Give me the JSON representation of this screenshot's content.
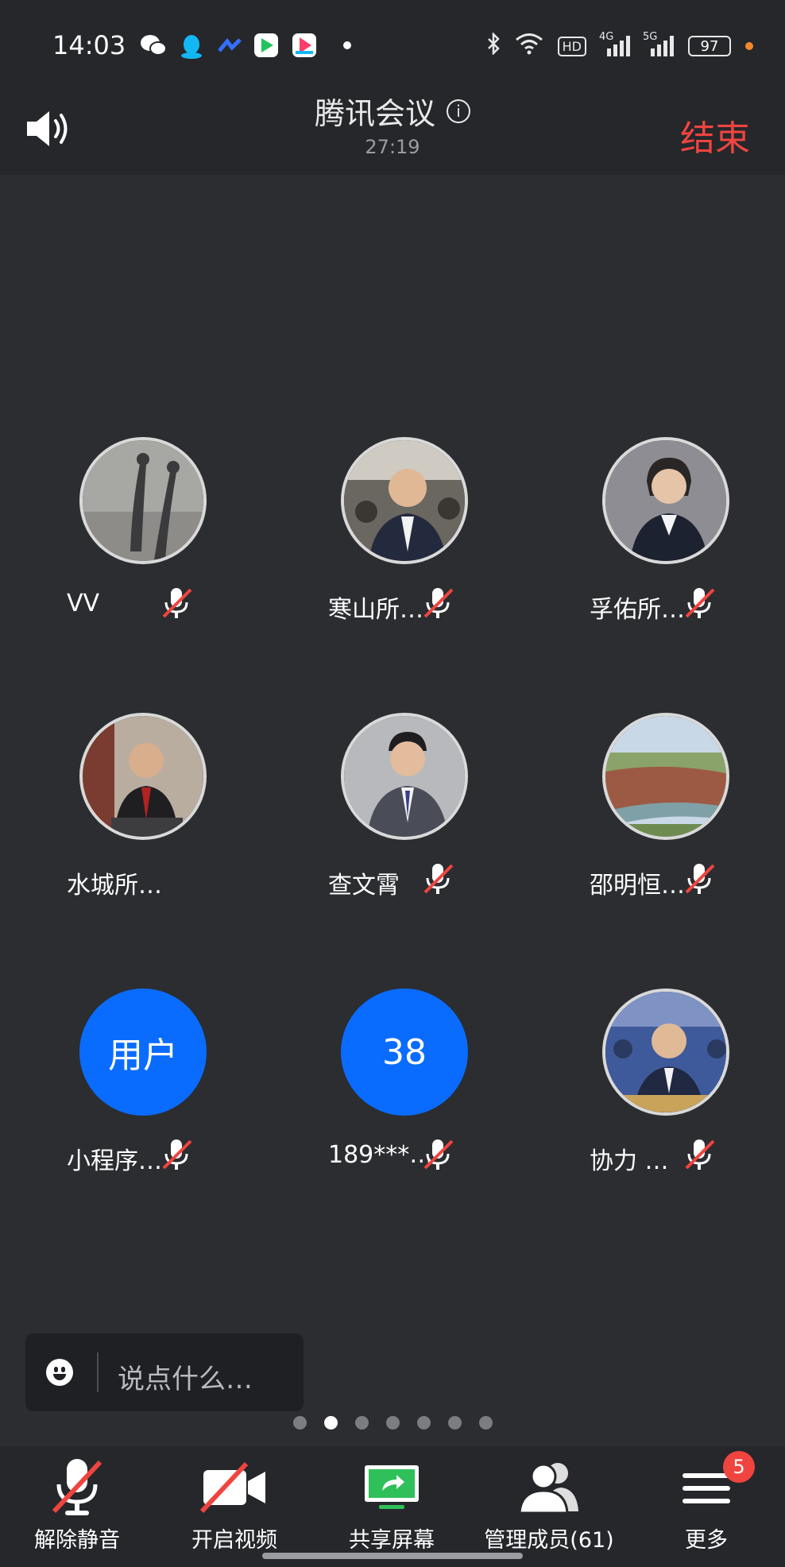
{
  "status_bar": {
    "time": "14:03",
    "app_icons": [
      {
        "icon": "wechat-icon",
        "color": "#ffffff"
      },
      {
        "icon": "qq-icon",
        "color": "#12b7f5"
      },
      {
        "icon": "feishu-icon",
        "color": "#3370ff"
      },
      {
        "icon": "video-app-icon",
        "color": "#20c45a"
      },
      {
        "icon": "music-app-icon",
        "color": "#ff3d6b"
      }
    ],
    "hd_label": "HD",
    "net_4g": "4G",
    "net_5g": "5G",
    "battery": "97"
  },
  "header": {
    "title": "腾讯会议",
    "timer": "27:19",
    "end_label": "结束"
  },
  "participants": [
    {
      "name": "VV",
      "avatar_type": "photo",
      "muted": true
    },
    {
      "name": "寒山所…",
      "avatar_type": "photo",
      "muted": true
    },
    {
      "name": "孚佑所…",
      "avatar_type": "photo",
      "muted": true
    },
    {
      "name": "水城所…",
      "avatar_type": "photo",
      "muted": false
    },
    {
      "name": "查文霄",
      "avatar_type": "photo",
      "muted": true
    },
    {
      "name": "邵明恒…",
      "avatar_type": "photo",
      "muted": true
    },
    {
      "name": "小程序…",
      "avatar_type": "initials",
      "initials": "用户",
      "muted": true
    },
    {
      "name": "189***…",
      "avatar_type": "initials",
      "initials": "38",
      "muted": true
    },
    {
      "name": "协力 …",
      "avatar_type": "photo",
      "muted": true
    }
  ],
  "chat": {
    "placeholder": "说点什么…"
  },
  "pagination": {
    "total": 7,
    "current": 2
  },
  "toolbar": {
    "unmute_label": "解除静音",
    "video_label": "开启视频",
    "share_label": "共享屏幕",
    "members_label": "管理成员(61)",
    "more_label": "更多",
    "more_badge": "5"
  },
  "colors": {
    "accent_blue": "#0a6cff",
    "end_red": "#f0443f",
    "share_green": "#2fc05a",
    "background": "#2b2d31",
    "bar": "#25272b"
  }
}
